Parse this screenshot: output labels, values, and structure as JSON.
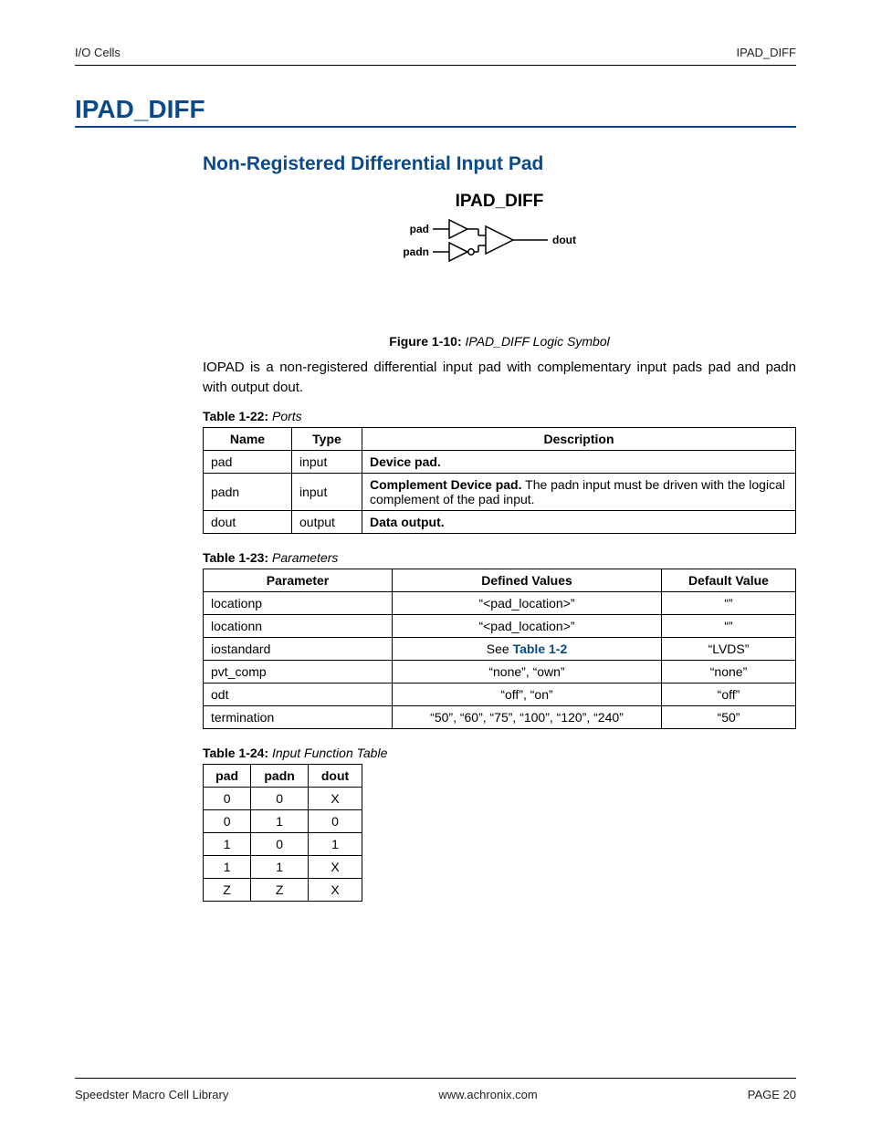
{
  "header": {
    "left": "I/O Cells",
    "right": "IPAD_DIFF"
  },
  "h1": "IPAD_DIFF",
  "h2": "Non-Registered Differential Input Pad",
  "figure": {
    "title": "IPAD_DIFF",
    "labels": {
      "pad": "pad",
      "padn": "padn",
      "dout": "dout"
    },
    "caption_prefix": "Figure 1-10:",
    "caption_text": "IPAD_DIFF Logic Symbol"
  },
  "paragraph": "IOPAD is a non-registered differential input pad with complementary input pads pad and padn with output dout.",
  "table_ports": {
    "caption_prefix": "Table 1-22:",
    "caption_text": "Ports",
    "headers": [
      "Name",
      "Type",
      "Description"
    ],
    "rows": [
      {
        "name": "pad",
        "type": "input",
        "desc_bold": "Device pad.",
        "desc_rest": ""
      },
      {
        "name": "padn",
        "type": "input",
        "desc_bold": "Complement Device pad.",
        "desc_rest": " The padn input must be driven with the logical complement of the pad input."
      },
      {
        "name": "dout",
        "type": "output",
        "desc_bold": "Data output.",
        "desc_rest": ""
      }
    ]
  },
  "table_params": {
    "caption_prefix": "Table 1-23:",
    "caption_text": "Parameters",
    "headers": [
      "Parameter",
      "Defined Values",
      "Default Value"
    ],
    "link_text": "Table 1-2",
    "link_prefix": "See ",
    "rows": [
      {
        "param": "locationp",
        "defined": "“<pad_location>”",
        "default": "“”"
      },
      {
        "param": "locationn",
        "defined": "“<pad_location>”",
        "default": "“”"
      },
      {
        "param": "iostandard",
        "defined": null,
        "default": "“LVDS”"
      },
      {
        "param": "pvt_comp",
        "defined": "“none”, “own”",
        "default": "“none”"
      },
      {
        "param": "odt",
        "defined": "“off”, “on”",
        "default": "“off”"
      },
      {
        "param": "termination",
        "defined": "“50”, “60”, “75”, “100”, “120”, “240”",
        "default": "“50”"
      }
    ]
  },
  "table_func": {
    "caption_prefix": "Table 1-24:",
    "caption_text": "Input Function Table",
    "headers": [
      "pad",
      "padn",
      "dout"
    ],
    "rows": [
      [
        "0",
        "0",
        "X"
      ],
      [
        "0",
        "1",
        "0"
      ],
      [
        "1",
        "0",
        "1"
      ],
      [
        "1",
        "1",
        "X"
      ],
      [
        "Z",
        "Z",
        "X"
      ]
    ]
  },
  "footer": {
    "left": "Speedster Macro Cell Library",
    "center": "www.achronix.com",
    "right_label": "PAGE ",
    "right_num": "20"
  }
}
